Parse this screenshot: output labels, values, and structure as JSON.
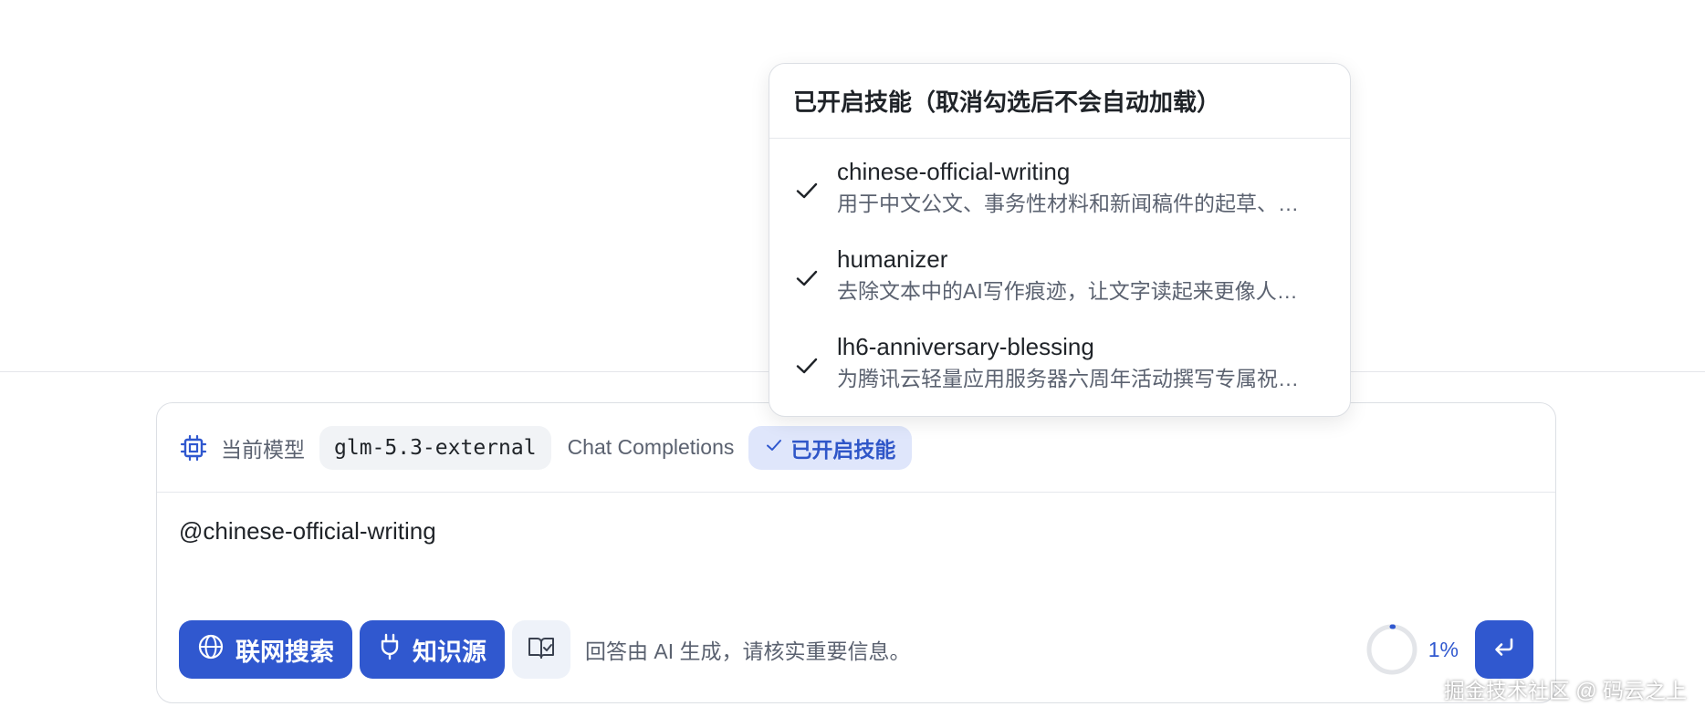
{
  "popover": {
    "title": "已开启技能（取消勾选后不会自动加载）",
    "skills": [
      {
        "name": "chinese-official-writing",
        "description": "用于中文公文、事务性材料和新闻稿件的起草、…"
      },
      {
        "name": "humanizer",
        "description": "去除文本中的AI写作痕迹，让文字读起来更像人…"
      },
      {
        "name": "lh6-anniversary-blessing",
        "description": "为腾讯云轻量应用服务器六周年活动撰写专属祝…"
      }
    ]
  },
  "header": {
    "model_label": "当前模型",
    "model_name": "glm-5.3-external",
    "api_type": "Chat Completions",
    "skills_button": "已开启技能"
  },
  "input": {
    "value": "@chinese-official-writing"
  },
  "footer": {
    "web_search": "联网搜索",
    "knowledge_source": "知识源",
    "disclaimer": "回答由 AI 生成，请核实重要信息。",
    "progress": 0.01,
    "progress_text": "1%"
  },
  "watermark": "掘金技术社区 @ 码云之上",
  "colors": {
    "accent": "#3058cf",
    "accent_soft": "#dfe6fb",
    "muted_text": "#5b6270"
  }
}
